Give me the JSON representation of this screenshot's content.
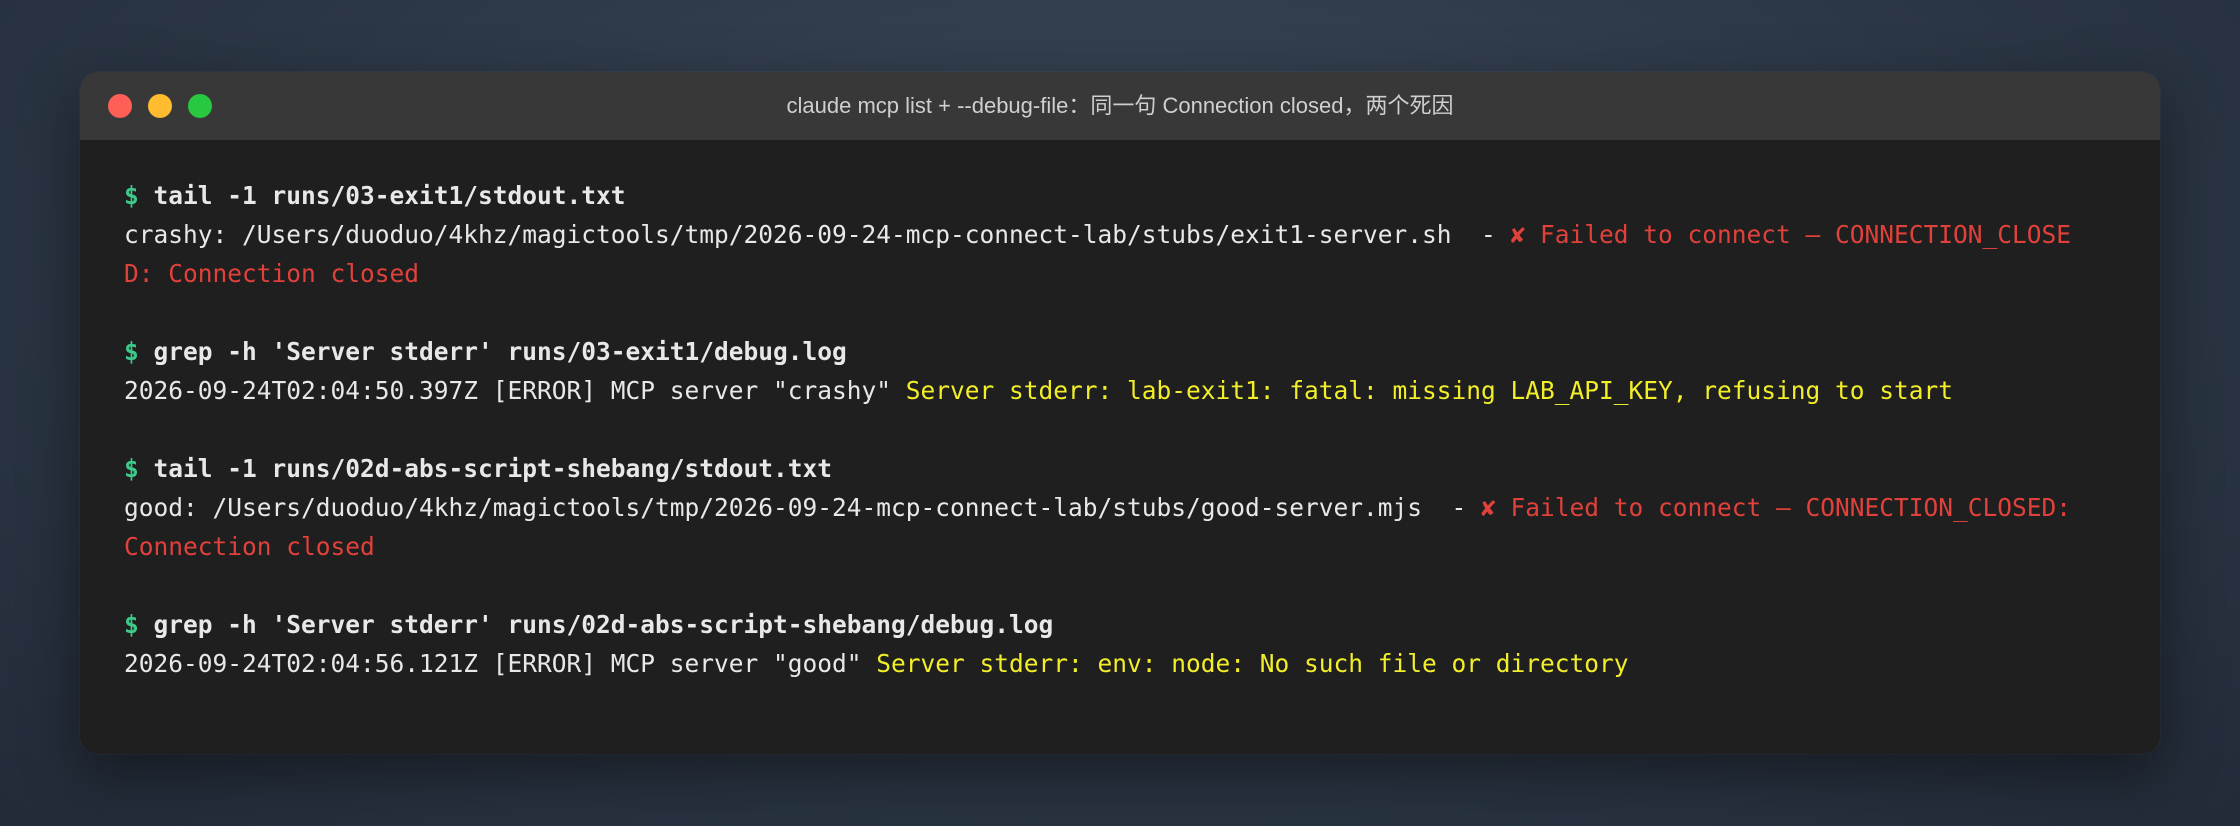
{
  "window": {
    "title": "claude mcp list + --debug-file：同一句 Connection closed，两个死因"
  },
  "terminal": {
    "prompt": "$",
    "blocks": [
      {
        "command": "tail -1 runs/03-exit1/stdout.txt",
        "output_line1_plain": "crashy: /Users/duoduo/4khz/magictools/tmp/2026-09-24-mcp-connect-lab/stubs/exit1-server.sh  - ",
        "output_line1_error": "✘ Failed to connect — CONNECTION_CLOSE",
        "output_line2_error": "D: Connection closed"
      },
      {
        "command": "grep -h 'Server stderr' runs/03-exit1/debug.log",
        "output_plain": "2026-09-24T02:04:50.397Z [ERROR] MCP server \"crashy\" ",
        "output_highlight": "Server stderr: lab-exit1: fatal: missing LAB_API_KEY, refusing to start"
      },
      {
        "command": "tail -1 runs/02d-abs-script-shebang/stdout.txt",
        "output_line1_plain": "good: /Users/duoduo/4khz/magictools/tmp/2026-09-24-mcp-connect-lab/stubs/good-server.mjs  - ",
        "output_line1_error": "✘ Failed to connect — CONNECTION_CLOSED:",
        "output_line2_error": "Connection closed"
      },
      {
        "command": "grep -h 'Server stderr' runs/02d-abs-script-shebang/debug.log",
        "output_plain": "2026-09-24T02:04:56.121Z [ERROR] MCP server \"good\" ",
        "output_highlight": "Server stderr: env: node: No such file or directory"
      }
    ]
  },
  "colors": {
    "prompt": "#3dc989",
    "error": "#e0413b",
    "highlight": "#f2ee2a",
    "text": "#e8e8e8",
    "background": "#1f1f1f",
    "titlebar": "#383838"
  }
}
